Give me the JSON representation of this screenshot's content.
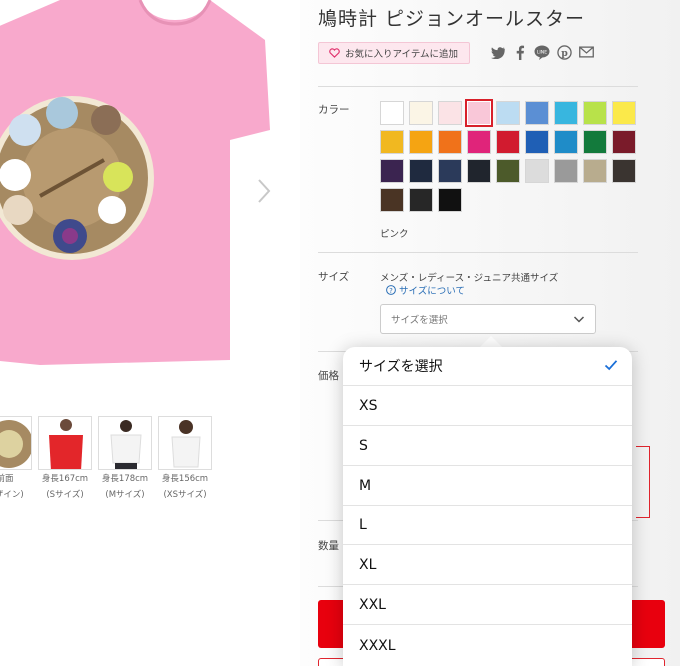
{
  "product": {
    "title": "鳩時計 ピジョンオールスター",
    "favorite_label": "お気に入りアイテムに追加"
  },
  "share_icons": [
    "twitter-icon",
    "facebook-icon",
    "line-icon",
    "pinterest-icon",
    "mail-icon"
  ],
  "color": {
    "label": "カラー",
    "selected_name": "ピンク",
    "swatches": [
      "#ffffff",
      "#fbf5e6",
      "#fbe3e6",
      "#f9c7d8",
      "#bcdcf2",
      "#5b8fd4",
      "#38b6df",
      "#b8e24a",
      "#fbe94a",
      "#f1b820",
      "#f5a412",
      "#f0721a",
      "#e0247a",
      "#d11b2f",
      "#1f5fb5",
      "#1f8cc8",
      "#137a3c",
      "#7a1b2a",
      "#3b2450",
      "#1f2a3f",
      "#2b3a5a",
      "#20252d",
      "#4c5a2a",
      "#dcdcdc",
      "#9a9a9a",
      "#b8ac8e",
      "#3a3430",
      "#4a3424",
      "#272727",
      "#111111"
    ],
    "selected_index": 3
  },
  "size": {
    "label": "サイズ",
    "note": "メンズ・レディース・ジュニア共通サイズ",
    "help_link": "サイズについて",
    "select_placeholder": "サイズを選択"
  },
  "price": {
    "label": "価格"
  },
  "quantity": {
    "label": "数量"
  },
  "thumbnails": [
    {
      "caption_line1": "前面",
      "caption_line2": "デザイン)"
    },
    {
      "caption_line1": "身長167cm",
      "caption_line2": "(Sサイズ)"
    },
    {
      "caption_line1": "身長178cm",
      "caption_line2": "(Mサイズ)"
    },
    {
      "caption_line1": "身長156cm",
      "caption_line2": "(XSサイズ)"
    }
  ],
  "picker": {
    "options": [
      "サイズを選択",
      "XS",
      "S",
      "M",
      "L",
      "XL",
      "XXL",
      "XXXL"
    ],
    "selected_index": 0
  },
  "colors": {
    "accent": "#e8000e",
    "link": "#2b6fb6",
    "shirt": "#f8a9cc"
  }
}
